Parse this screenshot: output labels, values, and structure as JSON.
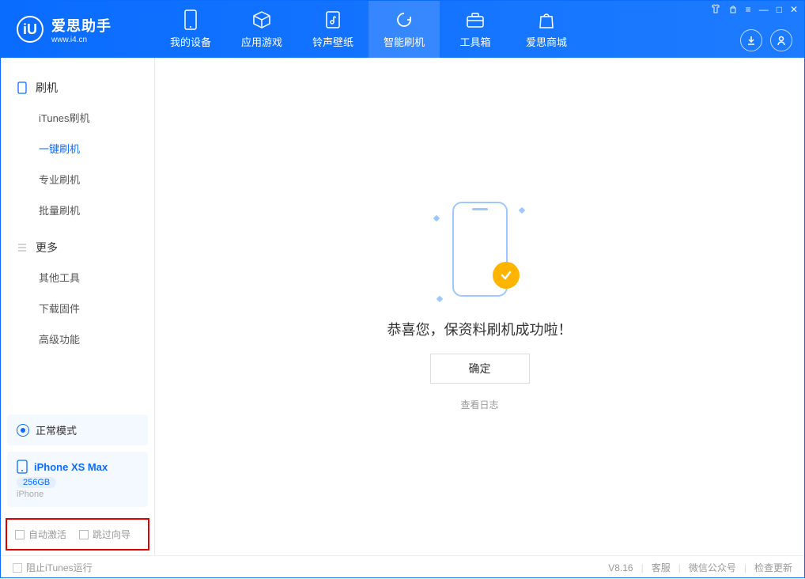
{
  "app": {
    "name": "爱思助手",
    "url": "www.i4.cn",
    "logo_letter": "iU"
  },
  "nav": {
    "tabs": [
      {
        "label": "我的设备"
      },
      {
        "label": "应用游戏"
      },
      {
        "label": "铃声壁纸"
      },
      {
        "label": "智能刷机"
      },
      {
        "label": "工具箱"
      },
      {
        "label": "爱思商城"
      }
    ]
  },
  "sidebar": {
    "section1_title": "刷机",
    "section1_items": [
      "iTunes刷机",
      "一键刷机",
      "专业刷机",
      "批量刷机"
    ],
    "section2_title": "更多",
    "section2_items": [
      "其他工具",
      "下载固件",
      "高级功能"
    ]
  },
  "status": {
    "mode_label": "正常模式"
  },
  "device": {
    "name": "iPhone XS Max",
    "storage": "256GB",
    "type": "iPhone"
  },
  "options": {
    "auto_activate": "自动激活",
    "skip_guide": "跳过向导"
  },
  "main": {
    "success_msg": "恭喜您，保资料刷机成功啦！",
    "ok_label": "确定",
    "view_log": "查看日志"
  },
  "footer": {
    "block_itunes": "阻止iTunes运行",
    "version": "V8.16",
    "links": [
      "客服",
      "微信公众号",
      "检查更新"
    ]
  }
}
